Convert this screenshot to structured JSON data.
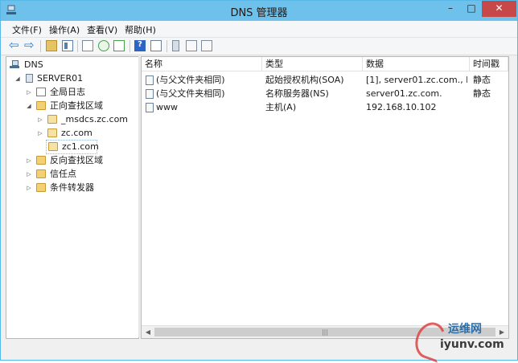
{
  "window": {
    "title": "DNS 管理器",
    "controls": {
      "minimize": "–",
      "maximize": "□",
      "close": "✕"
    }
  },
  "menu": [
    {
      "label": "文件(F)"
    },
    {
      "label": "操作(A)"
    },
    {
      "label": "查看(V)"
    },
    {
      "label": "帮助(H)"
    }
  ],
  "toolbar": {
    "back_glyph": "⇦",
    "forward_glyph": "⇨",
    "help_glyph": "?"
  },
  "tree": {
    "root": "DNS",
    "server": "SERVER01",
    "global_log": "全局日志",
    "forward_zones": "正向查找区域",
    "zones": [
      "_msdcs.zc.com",
      "zc.com",
      "zc1.com"
    ],
    "reverse_zones": "反向查找区域",
    "trust_points": "信任点",
    "conditional_forwarders": "条件转发器",
    "selected": "zc1.com"
  },
  "list": {
    "columns": [
      "名称",
      "类型",
      "数据",
      "时间戳"
    ],
    "rows": [
      {
        "name": "(与父文件夹相同)",
        "type": "起始授权机构(SOA)",
        "data": "[1], server01.zc.com., h...",
        "timestamp": "静态"
      },
      {
        "name": "(与父文件夹相同)",
        "type": "名称服务器(NS)",
        "data": "server01.zc.com.",
        "timestamp": "静态"
      },
      {
        "name": "www",
        "type": "主机(A)",
        "data": "192.168.10.102",
        "timestamp": ""
      }
    ]
  },
  "scrollbar": {
    "left": "◀",
    "right": "▶",
    "grip": "|||"
  },
  "watermark": {
    "top": "运维网",
    "bottom": "iyunv.com"
  },
  "colors": {
    "titlebar": "#6ec1ea",
    "close": "#c74848"
  }
}
